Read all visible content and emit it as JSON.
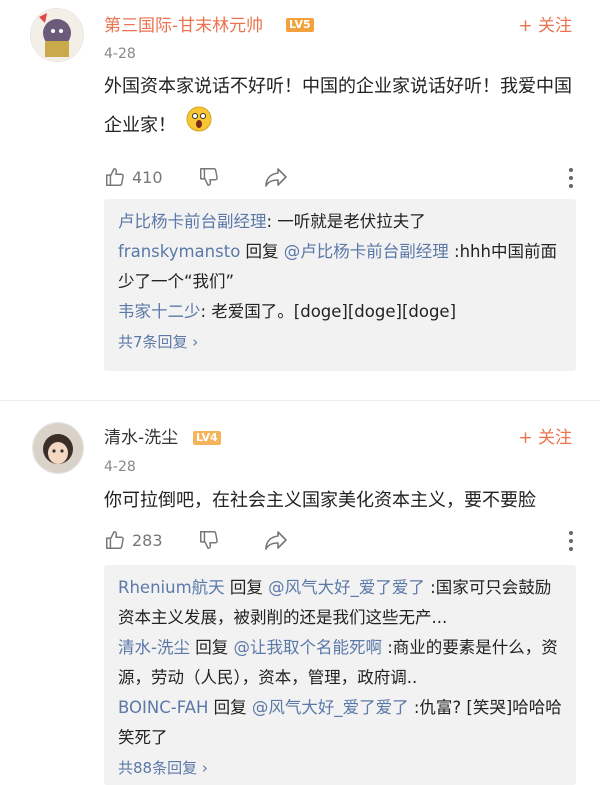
{
  "comments": [
    {
      "username": "第三国际-甘末林元帅",
      "level": "LV5",
      "follow": "+ 关注",
      "date": "4-28",
      "text": "外国资本家说话不好听！中国的企业家说话好听！我爱中国企业家！",
      "likes": "410",
      "replies": [
        {
          "author": "卢比杨卡前台副经理",
          "mention": "",
          "text": ": 一听就是老伏拉夫了"
        },
        {
          "author": "franskymansto",
          "reply_word": " 回复 ",
          "mention": "@卢比杨卡前台副经理",
          "text": " :hhh中国前面少了一个“我们”"
        },
        {
          "author": "韦家十二少",
          "mention": "",
          "text": ": 老爱国了。[doge][doge][doge]"
        }
      ],
      "total_replies": "共7条回复 ›"
    },
    {
      "username": "清水-洗尘",
      "level": "LV4",
      "follow": "+ 关注",
      "date": "4-28",
      "text": "你可拉倒吧，在社会主义国家美化资本主义，要不要脸",
      "likes": "283",
      "replies": [
        {
          "author": "Rhenium航天",
          "reply_word": " 回复 ",
          "mention": "@风气大好_爱了爱了",
          "text": " :国家可只会鼓励资本主义发展，被剥削的还是我们这些无产..."
        },
        {
          "author": "清水-洗尘",
          "reply_word": " 回复 ",
          "mention": "@让我取个名能死啊",
          "text": " :商业的要素是什么，资源，劳动（人民），资本，管理，政府调.."
        },
        {
          "author": "BOINC-FAH",
          "reply_word": " 回复 ",
          "mention": "@风气大好_爱了爱了",
          "text": " :仇富? [笑哭]哈哈哈笑死了"
        }
      ],
      "total_replies": "共88条回复 ›"
    }
  ],
  "colors": {
    "accent": "#eb7350",
    "link": "#5b79a8",
    "lv5": "#f2a23c",
    "lv4": "#f5b45a"
  }
}
